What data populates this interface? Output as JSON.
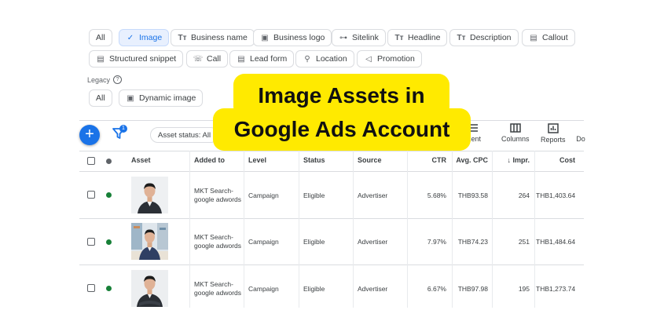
{
  "filters": {
    "row1": [
      {
        "label": "All",
        "icon": "",
        "selected": false
      },
      {
        "label": "Image",
        "icon": "check-icon",
        "selected": true
      },
      {
        "label": "Business name",
        "icon": "text-format-icon",
        "selected": false
      },
      {
        "label": "Business logo",
        "icon": "image-icon",
        "selected": false
      },
      {
        "label": "Sitelink",
        "icon": "link-icon",
        "selected": false
      },
      {
        "label": "Headline",
        "icon": "text-format-icon",
        "selected": false
      },
      {
        "label": "Description",
        "icon": "text-format-icon",
        "selected": false
      },
      {
        "label": "Callout",
        "icon": "callout-icon",
        "selected": false
      }
    ],
    "row2": [
      {
        "label": "Structured snippet",
        "icon": "list-icon",
        "selected": false
      },
      {
        "label": "Call",
        "icon": "phone-icon",
        "selected": false
      },
      {
        "label": "Lead form",
        "icon": "form-icon",
        "selected": false
      },
      {
        "label": "Location",
        "icon": "location-pin-icon",
        "selected": false
      },
      {
        "label": "Promotion",
        "icon": "megaphone-icon",
        "selected": false
      }
    ],
    "legacy_label": "Legacy",
    "legacy": [
      {
        "label": "All",
        "icon": ""
      },
      {
        "label": "Dynamic image",
        "icon": "image-icon"
      }
    ]
  },
  "toolbar": {
    "filter_count": "1",
    "asset_status": "Asset status: All",
    "segment": "ment",
    "columns": "Columns",
    "reports": "Reports",
    "download": "Do"
  },
  "table": {
    "headers": {
      "asset": "Asset",
      "added_to": "Added to",
      "level": "Level",
      "status": "Status",
      "source": "Source",
      "ctr": "CTR",
      "avg_cpc": "Avg. CPC",
      "impr": "Impr.",
      "cost": "Cost"
    },
    "rows": [
      {
        "added_to": "MKT Search-google adwords",
        "level": "Campaign",
        "status": "Eligible",
        "source": "Advertiser",
        "ctr": "5.68%",
        "avg_cpc": "THB93.58",
        "impr": "264",
        "cost": "THB1,403.64"
      },
      {
        "added_to": "MKT Search-google adwords",
        "level": "Campaign",
        "status": "Eligible",
        "source": "Advertiser",
        "ctr": "7.97%",
        "avg_cpc": "THB74.23",
        "impr": "251",
        "cost": "THB1,484.64"
      },
      {
        "added_to": "MKT Search-google adwords",
        "level": "Campaign",
        "status": "Eligible",
        "source": "Advertiser",
        "ctr": "6.67%",
        "avg_cpc": "THB97.98",
        "impr": "195",
        "cost": "THB1,273.74"
      }
    ]
  },
  "overlay": {
    "line1": "Image Assets in",
    "line2": "Google Ads Account"
  },
  "colors": {
    "accent": "#1a73e8",
    "eligible_dot": "#188038",
    "overlay_bg": "#ffea00"
  }
}
